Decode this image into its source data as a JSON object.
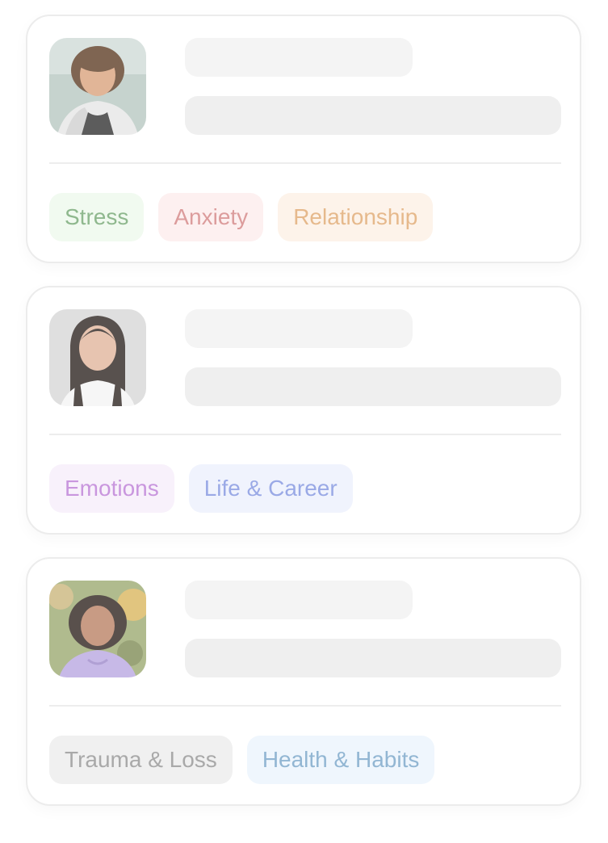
{
  "cards": [
    {
      "avatar_desc": "therapist-photo",
      "tags": [
        {
          "label": "Stress",
          "bg": "#f1faf0",
          "fg": "#8fb88e"
        },
        {
          "label": "Anxiety",
          "bg": "#fdf0f0",
          "fg": "#dc9c9c"
        },
        {
          "label": "Relationship",
          "bg": "#fdf3ea",
          "fg": "#e6b98c"
        }
      ]
    },
    {
      "avatar_desc": "therapist-photo",
      "tags": [
        {
          "label": "Emotions",
          "bg": "#f8f1fb",
          "fg": "#c996de"
        },
        {
          "label": "Life & Career",
          "bg": "#f0f3fd",
          "fg": "#9aa9e6"
        }
      ]
    },
    {
      "avatar_desc": "therapist-photo",
      "tags": [
        {
          "label": "Trauma & Loss",
          "bg": "#f0f0f0",
          "fg": "#a9a9a9"
        },
        {
          "label": "Health & Habits",
          "bg": "#eff6fd",
          "fg": "#92b6d3"
        }
      ]
    }
  ]
}
